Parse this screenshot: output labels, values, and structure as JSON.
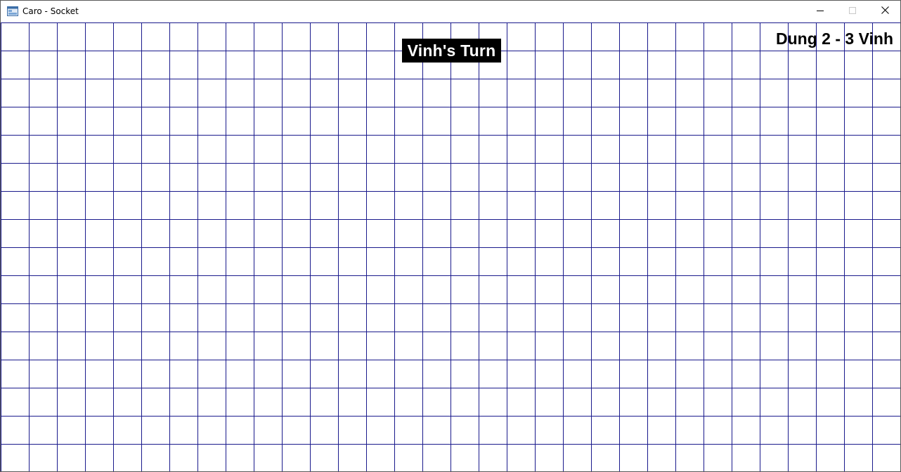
{
  "window": {
    "title": "Caro - Socket",
    "icon": "window-app-icon",
    "controls": {
      "minimize_icon": "minimize-icon",
      "maximize_icon": "maximize-icon",
      "close_icon": "close-icon"
    }
  },
  "game": {
    "turn_text": "Vinh's Turn",
    "score_text": "Dung 2 - 3 Vinh",
    "board": {
      "columns": 32,
      "rows": 16,
      "grid_color": "#1a1a8c"
    }
  }
}
